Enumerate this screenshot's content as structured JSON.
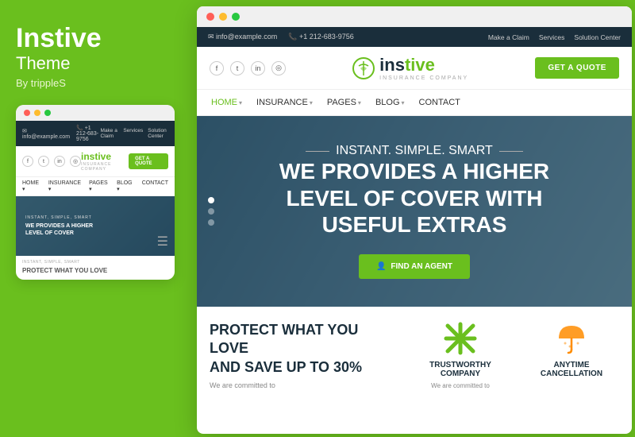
{
  "left_panel": {
    "theme_name": "Instive",
    "theme_sub": "Theme",
    "by_author": "By trippleS"
  },
  "mini_browser": {
    "topbar": {
      "email": "info@example.com",
      "phone": "+1 212-683-9756",
      "links": [
        "Make a Claim",
        "Services",
        "Solution Center"
      ]
    },
    "header": {
      "logo": "instive",
      "logo_tagline": "INSURANCE COMPANY",
      "get_quote": "GET A QUOTE"
    },
    "hero": {
      "tagline": "INSTANT, SIMPLE, SMART",
      "title": "WE PROVIDES A HIGHER LEVEL OF COVER"
    },
    "footer": {
      "title": "PROTECT WHAT YOU LOVE",
      "tagline": "INSTANT, SIMPLE, SMART"
    }
  },
  "main_browser": {
    "topbar": {
      "email": "info@example.com",
      "phone": "+1 212-683-9756",
      "links": [
        "Make a Claim",
        "Services",
        "Solution Center"
      ]
    },
    "header": {
      "social_icons": [
        "f",
        "t",
        "in",
        "📷"
      ],
      "logo_prefix": "ins",
      "logo_suffix": "tive",
      "logo_tagline": "INSURANCE COMPANY",
      "get_quote": "GET A QUOTE"
    },
    "nav": {
      "items": [
        {
          "label": "HOME",
          "has_dropdown": true
        },
        {
          "label": "INSURANCE",
          "has_dropdown": true
        },
        {
          "label": "PAGES",
          "has_dropdown": true
        },
        {
          "label": "BLOG",
          "has_dropdown": true
        },
        {
          "label": "CONTACT",
          "has_dropdown": false
        }
      ]
    },
    "hero": {
      "tagline": "INSTANT. SIMPLE. SMART",
      "title_line1": "WE PROVIDES A HIGHER",
      "title_line2": "LEVEL OF COVER WITH",
      "title_line3": "USEFUL EXTRAS",
      "cta_button": "FIND AN AGENT"
    },
    "bottom": {
      "title_line1": "PROTECT WHAT YOU LOVE",
      "title_line2": "AND SAVE UP TO 30%",
      "text": "We are committed to",
      "features": [
        {
          "title": "TRUSTWORTHY COMPANY",
          "text": "We are committed to",
          "icon_type": "cross"
        },
        {
          "title": "ANYTIME CANCELLATION",
          "text": "",
          "icon_type": "umbrella"
        }
      ]
    }
  }
}
